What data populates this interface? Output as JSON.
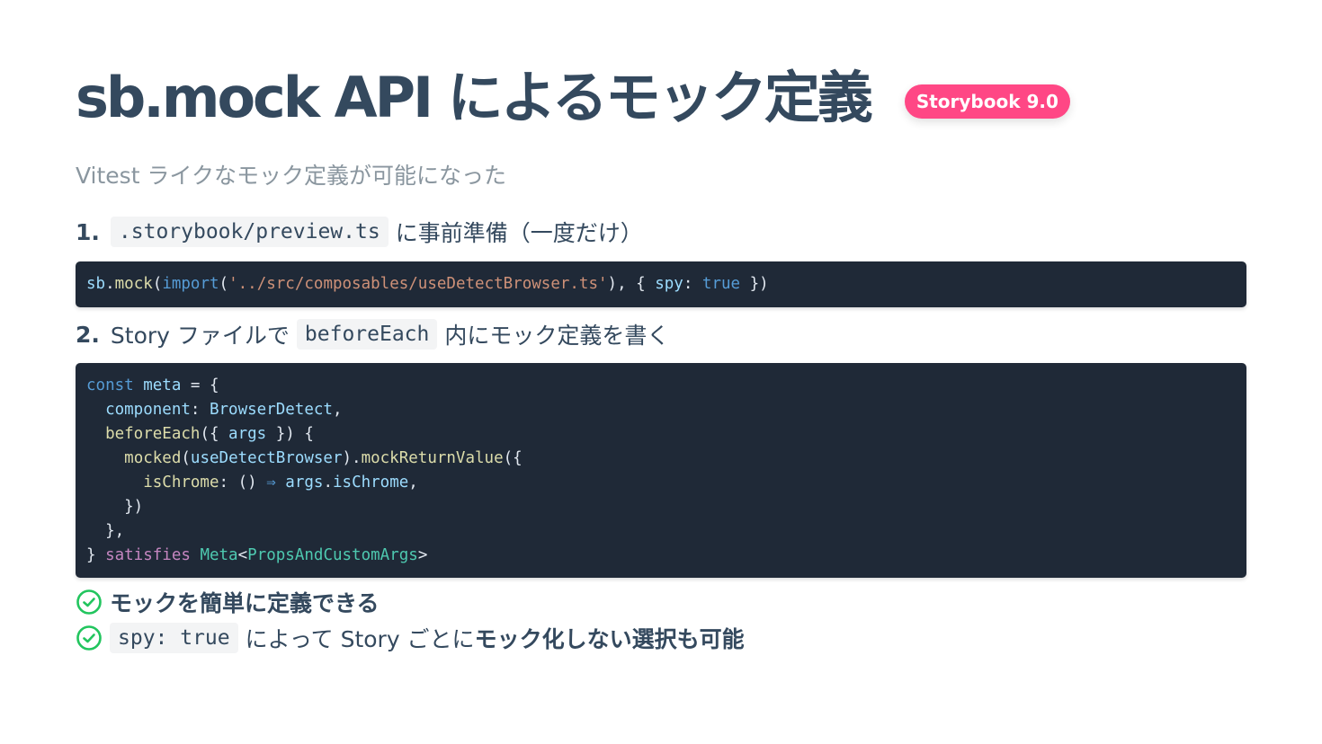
{
  "title": "sb.mock API によるモック定義",
  "badge": "Storybook 9.0",
  "subtitle": "Vitest ライクなモック定義が可能になった",
  "steps": [
    {
      "number": "1.",
      "code": ".storybook/preview.ts",
      "text_after": "に事前準備（一度だけ）"
    },
    {
      "number": "2.",
      "text_before": "Story ファイルで",
      "code": "beforeEach",
      "text_after": "内にモック定義を書く"
    }
  ],
  "code1": {
    "sb": "sb",
    "dot": ".",
    "mock": "mock",
    "paren_open": "(",
    "import": "import",
    "paren_open2": "(",
    "path": "'../src/composables/useDetectBrowser.ts'",
    "after_path": "), { ",
    "spy": "spy",
    "colon": ": ",
    "true": "true",
    "end": " })"
  },
  "code2": {
    "l1_const": "const",
    "l1_meta": "meta",
    "l1_rest": " = {",
    "l2_indent": "  ",
    "l2_component": "component",
    "l2_colon": ": ",
    "l2_value": "BrowserDetect",
    "l2_comma": ",",
    "l3_indent": "  ",
    "l3_fn": "beforeEach",
    "l3_open": "({ ",
    "l3_args": "args",
    "l3_close": " }) {",
    "l4_indent": "    ",
    "l4_fn": "mocked",
    "l4_open": "(",
    "l4_arg": "useDetectBrowser",
    "l4_dot": ").",
    "l4_method": "mockReturnValue",
    "l4_end": "({",
    "l5_indent": "      ",
    "l5_prop": "isChrome",
    "l5_mid": ": () ",
    "l5_arrow": "⇒",
    "l5_sp": " ",
    "l5_args": "args",
    "l5_dot": ".",
    "l5_is": "isChrome",
    "l5_comma": ",",
    "l6": "    })",
    "l7": "  },",
    "l8_brace": "} ",
    "l8_satisfies": "satisfies",
    "l8_sp": " ",
    "l8_meta": "Meta",
    "l8_lt": "<",
    "l8_type": "PropsAndCustomArgs",
    "l8_gt": ">"
  },
  "checks": [
    {
      "icon": "check-circle-icon",
      "text": "モックを簡単に定義できる"
    },
    {
      "icon": "check-circle-icon",
      "code": "spy: true",
      "text_plain": "によって Story ごとに",
      "text_bold": "モック化しない選択も可能"
    }
  ],
  "colors": {
    "title": "#34495e",
    "badge_bg": "#ff4785",
    "code_bg": "#1f2937",
    "check_green": "#22c55e",
    "subtitle": "#8a969f"
  }
}
